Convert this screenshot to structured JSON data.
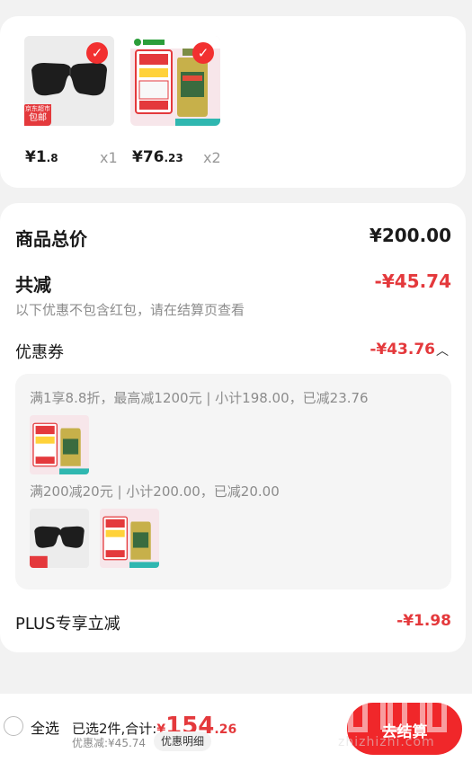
{
  "items": [
    {
      "name": "sunglasses",
      "badge_top": "京东超市",
      "badge": "包邮",
      "price_main": "¥1",
      "price_dec": ".8",
      "qty": "x1"
    },
    {
      "name": "engine-oil",
      "price_main": "¥76",
      "price_dec": ".23",
      "qty": "x2"
    }
  ],
  "summary": {
    "total_label": "商品总价",
    "total_value": "¥200.00",
    "reduce_label": "共减",
    "reduce_value": "-¥45.74",
    "note": "以下优惠不包含红包，请在结算页查看",
    "coupon_label": "优惠券",
    "coupon_value": "-¥43.76",
    "coupon_details": [
      "满1享8.8折，最高减1200元 | 小计198.00，已减23.76",
      "满200减20元 | 小计200.00，已减20.00"
    ],
    "plus_label": "PLUS专享立减",
    "plus_value": "-¥1.98"
  },
  "bottom": {
    "select_all": "全选",
    "selected_text": "已选2件,合计:",
    "total_symbol": "¥",
    "total_main": "154",
    "total_dec": ".26",
    "discount_text": "优惠减:¥45.74",
    "detail_button": "优惠明细",
    "checkout": "去结算"
  },
  "watermark": "值 | 什么值得买 zhizhizhi.com",
  "colors": {
    "accent": "#e4393c",
    "card": "#ffffff",
    "background": "#f2f2f2"
  }
}
